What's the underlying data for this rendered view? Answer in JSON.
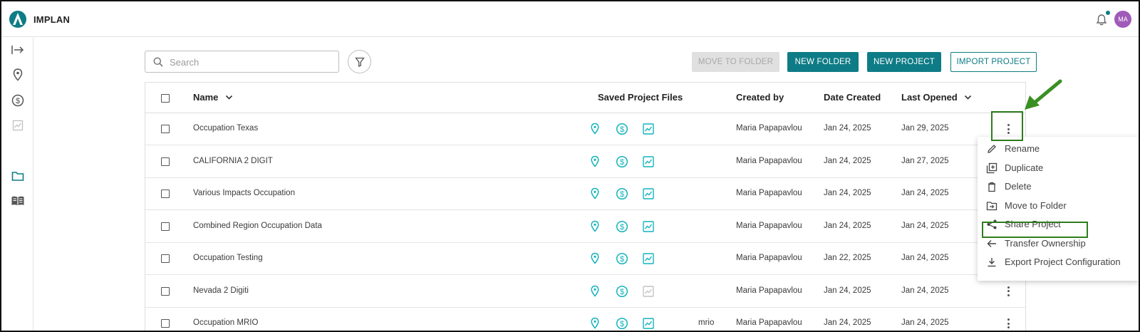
{
  "app": {
    "name": "IMPLAN",
    "user_initials": "MA"
  },
  "colors": {
    "accent": "#0e7c86",
    "icon_teal": "#15b3bd",
    "avatar": "#a05bb8",
    "annotation": "#2e7d1e"
  },
  "sidebar": {
    "items": [
      {
        "icon": "expand-arrow-icon"
      },
      {
        "icon": "map-pin-icon"
      },
      {
        "icon": "dollar-circle-icon"
      },
      {
        "icon": "chart-icon"
      },
      {
        "icon": "folder-icon"
      },
      {
        "icon": "book-icon"
      }
    ]
  },
  "toolbar": {
    "search_placeholder": "Search",
    "move_to_folder": "MOVE TO FOLDER",
    "new_folder": "NEW FOLDER",
    "new_project": "NEW PROJECT",
    "import_project": "IMPORT PROJECT"
  },
  "table": {
    "headers": {
      "name": "Name",
      "saved_files": "Saved Project Files",
      "created_by": "Created by",
      "date_created": "Date Created",
      "last_opened": "Last Opened"
    },
    "rows": [
      {
        "name": "Occupation Texas",
        "tag": "",
        "created_by": "Maria Papapavlou",
        "date_created": "Jan 24, 2025",
        "last_opened": "Jan 29, 2025",
        "has_results": true
      },
      {
        "name": "CALIFORNIA 2 DIGIT",
        "tag": "",
        "created_by": "Maria Papapavlou",
        "date_created": "Jan 24, 2025",
        "last_opened": "Jan 27, 2025",
        "has_results": true
      },
      {
        "name": "Various Impacts Occupation",
        "tag": "",
        "created_by": "Maria Papapavlou",
        "date_created": "Jan 24, 2025",
        "last_opened": "Jan 24, 2025",
        "has_results": true
      },
      {
        "name": "Combined Region Occupation Data",
        "tag": "",
        "created_by": "Maria Papapavlou",
        "date_created": "Jan 24, 2025",
        "last_opened": "Jan 24, 2025",
        "has_results": true
      },
      {
        "name": "Occupation Testing",
        "tag": "",
        "created_by": "Maria Papapavlou",
        "date_created": "Jan 22, 2025",
        "last_opened": "Jan 24, 2025",
        "has_results": true
      },
      {
        "name": "Nevada 2 Digiti",
        "tag": "",
        "created_by": "Maria Papapavlou",
        "date_created": "Jan 24, 2025",
        "last_opened": "Jan 24, 2025",
        "has_results": false
      },
      {
        "name": "Occupation MRIO",
        "tag": "mrio",
        "created_by": "Maria Papapavlou",
        "date_created": "Jan 24, 2025",
        "last_opened": "Jan 24, 2025",
        "has_results": true
      }
    ]
  },
  "context_menu": {
    "items": [
      {
        "label": "Rename",
        "icon": "pencil-icon"
      },
      {
        "label": "Duplicate",
        "icon": "duplicate-icon"
      },
      {
        "label": "Delete",
        "icon": "trash-icon"
      },
      {
        "label": "Move to Folder",
        "icon": "folder-move-icon"
      },
      {
        "label": "Share Project",
        "icon": "share-icon"
      },
      {
        "label": "Transfer Ownership",
        "icon": "arrow-left-icon"
      },
      {
        "label": "Export Project Configuration",
        "icon": "download-icon"
      }
    ]
  }
}
